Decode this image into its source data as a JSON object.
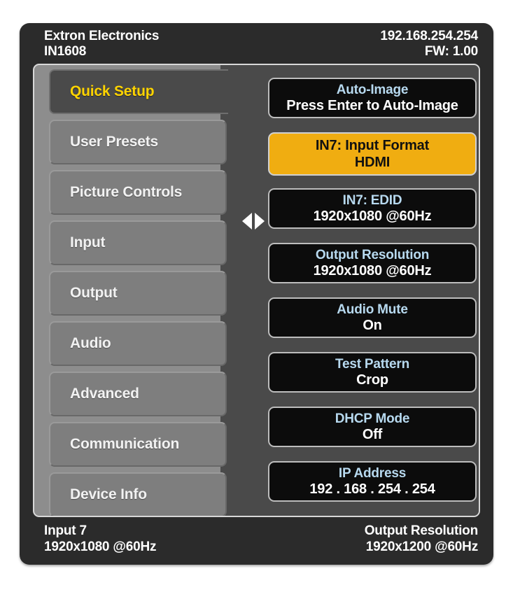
{
  "header": {
    "brand": "Extron Electronics",
    "model": "IN1608",
    "ip": "192.168.254.254",
    "firmware": "FW: 1.00"
  },
  "sidebar": {
    "items": [
      {
        "label": "Quick Setup",
        "state": "active"
      },
      {
        "label": "User Presets",
        "state": "normal"
      },
      {
        "label": "Picture Controls",
        "state": "normal"
      },
      {
        "label": "Input",
        "state": "normal"
      },
      {
        "label": "Output",
        "state": "normal"
      },
      {
        "label": "Audio",
        "state": "normal"
      },
      {
        "label": "Advanced",
        "state": "normal"
      },
      {
        "label": "Communication",
        "state": "normal"
      },
      {
        "label": "Device Info",
        "state": "normal"
      }
    ]
  },
  "options": {
    "buttons": [
      {
        "label": "Auto-Image",
        "value": "Press Enter to Auto-Image",
        "state": "normal"
      },
      {
        "label": "IN7: Input Format",
        "value": "HDMI",
        "state": "selected"
      },
      {
        "label": "IN7: EDID",
        "value": "1920x1080 @60Hz",
        "state": "normal"
      },
      {
        "label": "Output Resolution",
        "value": "1920x1080 @60Hz",
        "state": "normal"
      },
      {
        "label": "Audio Mute",
        "value": "On",
        "state": "normal"
      },
      {
        "label": "Test Pattern",
        "value": "Crop",
        "state": "normal"
      },
      {
        "label": "DHCP Mode",
        "value": "Off",
        "state": "normal"
      },
      {
        "label": "IP Address",
        "value": "192 . 168 . 254 . 254",
        "state": "normal"
      }
    ]
  },
  "nav": {
    "left_icon": "triangle-left-icon",
    "right_icon": "triangle-right-icon",
    "up_icon": "triangle-up-icon",
    "down_icon": "triangle-down-icon"
  },
  "footer": {
    "input_label": "Input 7",
    "input_value": "1920x1080 @60Hz",
    "output_label": "Output Resolution",
    "output_value": "1920x1200 @60Hz"
  },
  "colors": {
    "accent_selected": "#f0ad11",
    "active_menu_text": "#ffd400",
    "option_label": "#b7d9ef",
    "panel_bg": "#8d8d8d",
    "dark_bg": "#4a4a4a",
    "frame": "#2b2b2b"
  }
}
